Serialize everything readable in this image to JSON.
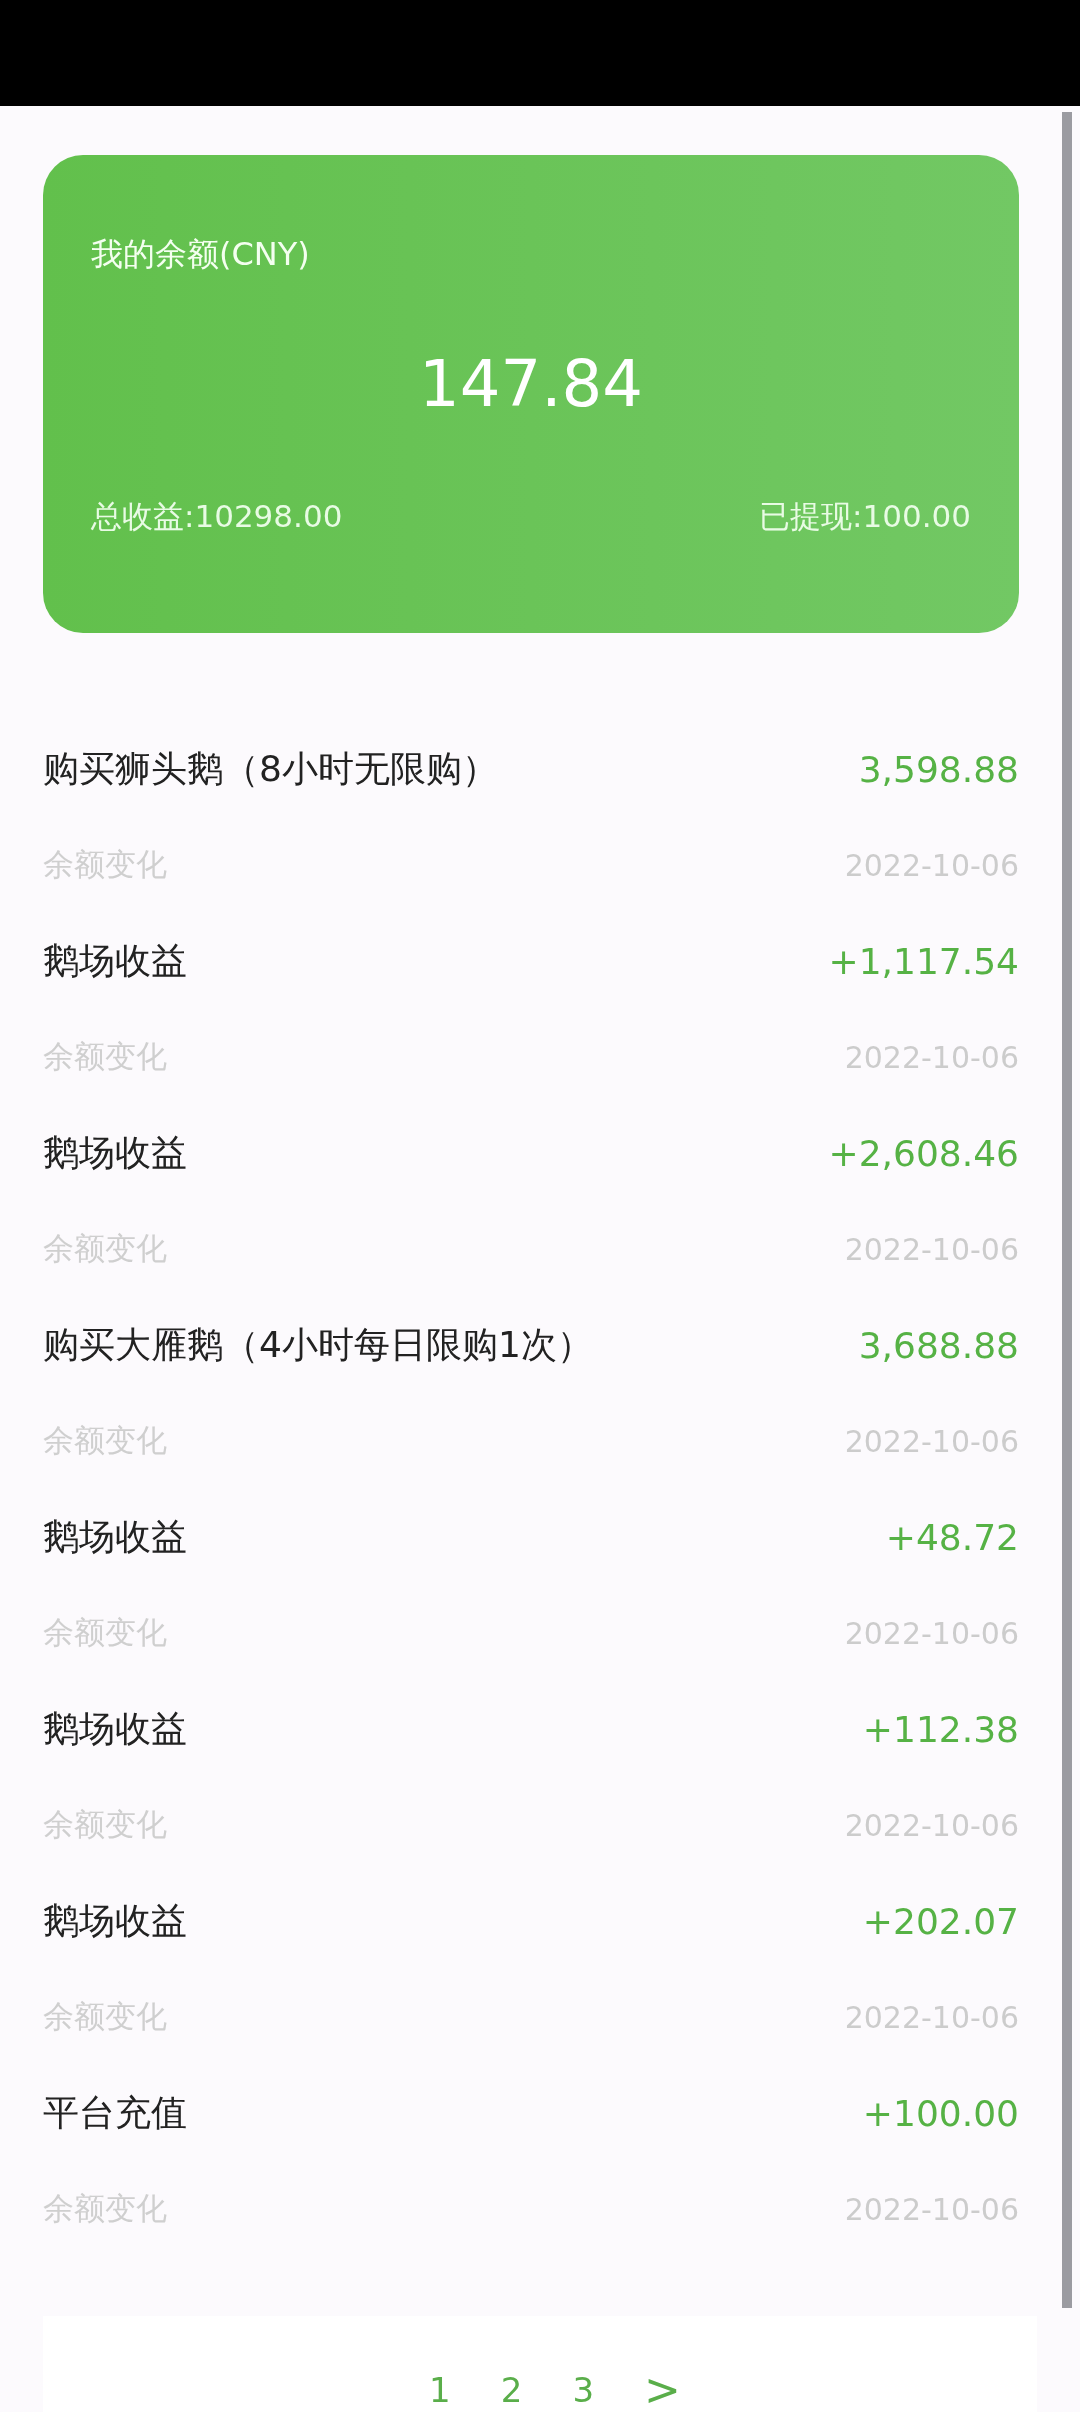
{
  "balance_card": {
    "title": "我的余额(CNY)",
    "amount": "147.84",
    "total_income": "总收益:10298.00",
    "withdrawn": "已提现:100.00"
  },
  "transactions": [
    {
      "title": "购买狮头鹅（8小时无限购）",
      "amount": "3,598.88",
      "type": "余额变化",
      "date": "2022-10-06"
    },
    {
      "title": "鹅场收益",
      "amount": "+1,117.54",
      "type": "余额变化",
      "date": "2022-10-06"
    },
    {
      "title": "鹅场收益",
      "amount": "+2,608.46",
      "type": "余额变化",
      "date": "2022-10-06"
    },
    {
      "title": "购买大雁鹅（4小时每日限购1次）",
      "amount": "3,688.88",
      "type": "余额变化",
      "date": "2022-10-06"
    },
    {
      "title": "鹅场收益",
      "amount": "+48.72",
      "type": "余额变化",
      "date": "2022-10-06"
    },
    {
      "title": "鹅场收益",
      "amount": "+112.38",
      "type": "余额变化",
      "date": "2022-10-06"
    },
    {
      "title": "鹅场收益",
      "amount": "+202.07",
      "type": "余额变化",
      "date": "2022-10-06"
    },
    {
      "title": "平台充值",
      "amount": "+100.00",
      "type": "余额变化",
      "date": "2022-10-06"
    }
  ],
  "pagination": {
    "pages": [
      "1",
      "2",
      "3"
    ],
    "next": ">"
  }
}
